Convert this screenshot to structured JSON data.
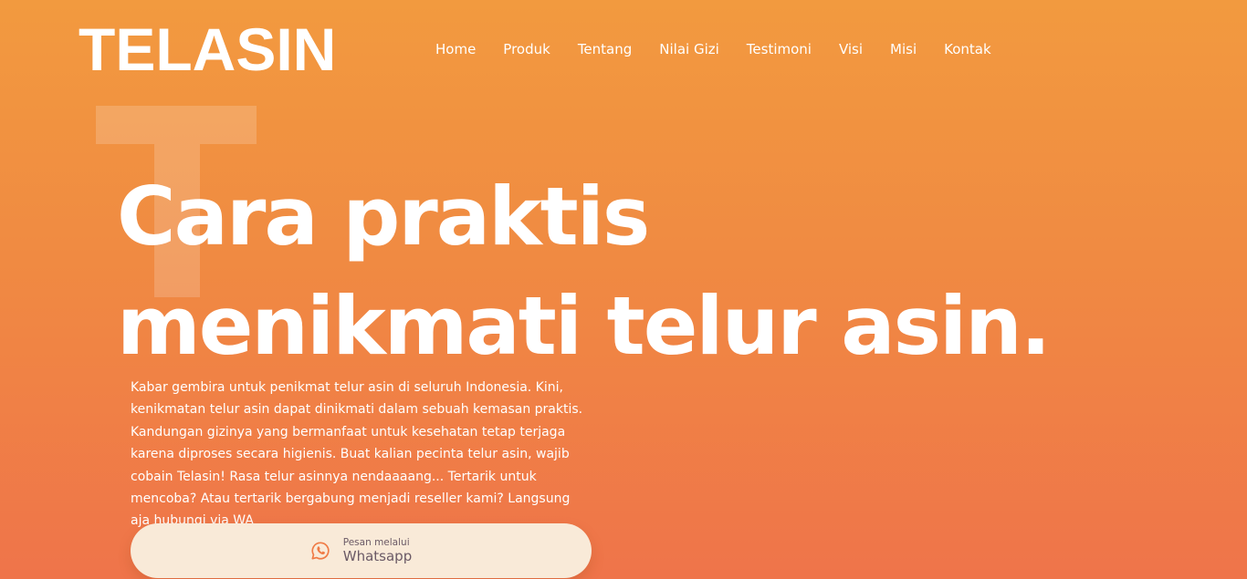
{
  "brand": {
    "name": "TELASIN"
  },
  "nav": {
    "items": [
      {
        "label": "Home"
      },
      {
        "label": "Produk"
      },
      {
        "label": "Tentang"
      },
      {
        "label": "Nilai Gizi"
      },
      {
        "label": "Testimoni"
      },
      {
        "label": "Visi"
      },
      {
        "label": "Misi"
      },
      {
        "label": "Kontak"
      }
    ]
  },
  "hero": {
    "headline": "Cara praktis menikmati telur asin.",
    "description": "Kabar gembira untuk penikmat telur asin di seluruh Indonesia. Kini, kenikmatan telur asin dapat dinikmati dalam sebuah kemasan praktis. Kandungan gizinya yang bermanfaat untuk kesehatan tetap terjaga karena diproses secara higienis. Buat kalian pecinta telur asin, wajib cobain Telasin! Rasa telur asinnya nendaaaang... Tertarik untuk mencoba? Atau tertarik bergabung menjadi reseller kami? Langsung aja hubungi via WA",
    "cta": {
      "small_label": "Pesan melalui",
      "label": "Whatsapp",
      "icon": "whatsapp-icon"
    }
  },
  "colors": {
    "background_top": "#f29a3f",
    "background_bottom": "#ef744a",
    "text": "#ffffff",
    "button_bg": "#f9ead8",
    "button_text": "#6b5a66",
    "icon_accent": "#f07a44"
  }
}
